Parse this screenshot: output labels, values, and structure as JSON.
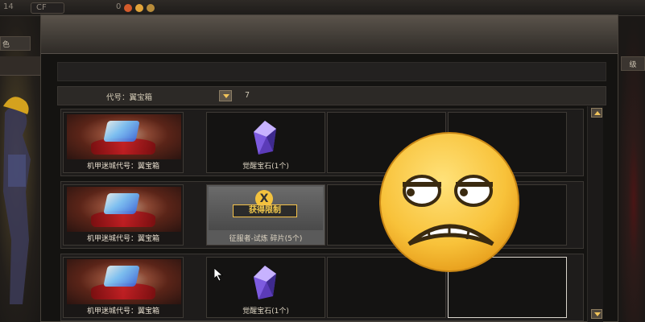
{
  "hud": {
    "left_num": "14",
    "pill_text": "CF",
    "coin_count": "0"
  },
  "left_tab": "色",
  "right_tab": "级",
  "filter": {
    "label": "代号：翼宝箱",
    "count": "7"
  },
  "rows": [
    {
      "box_label": "机甲迷城代号：翼宝箱",
      "items": [
        {
          "type": "crystal",
          "label": "觉醒宝石(1个)"
        },
        {
          "type": "empty",
          "label": ""
        },
        {
          "type": "empty",
          "label": ""
        }
      ]
    },
    {
      "box_label": "机甲迷城代号：翼宝箱",
      "items": [
        {
          "type": "badge",
          "badge_text": "获得限制",
          "label": "征服者-试炼 碎片(5个)"
        },
        {
          "type": "empty",
          "label": ""
        },
        {
          "type": "empty",
          "label": ""
        }
      ]
    },
    {
      "box_label": "机甲迷城代号：翼宝箱",
      "items": [
        {
          "type": "crystal",
          "label": "觉醒宝石(1个)"
        },
        {
          "type": "empty",
          "label": ""
        },
        {
          "type": "empty",
          "label": ""
        }
      ]
    }
  ],
  "colors": {
    "accent": "#f1c45a",
    "crystal_top": "#c8b0ff",
    "crystal_bottom": "#4a2a9a"
  }
}
